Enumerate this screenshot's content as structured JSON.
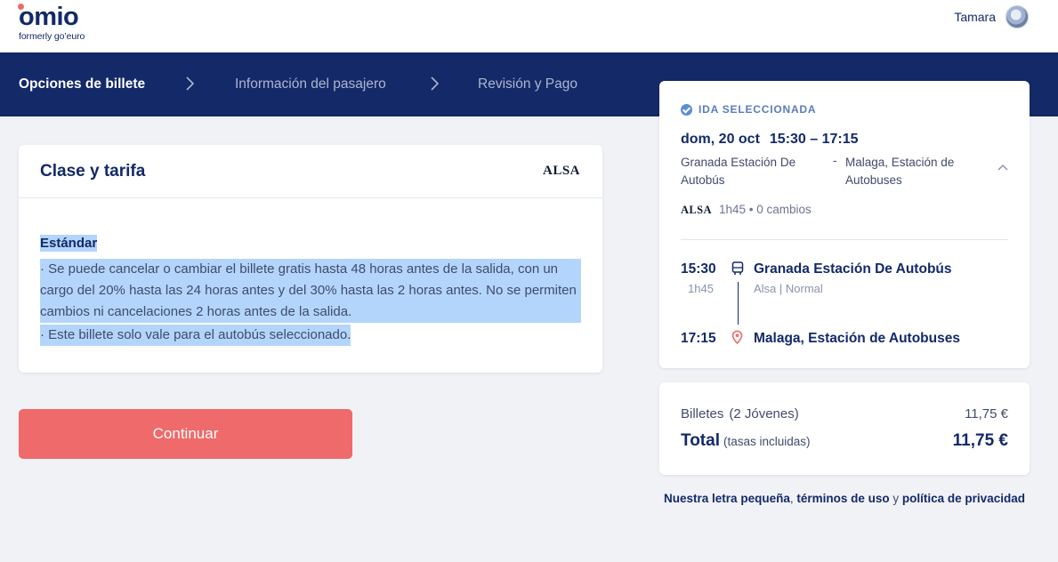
{
  "header": {
    "logo_text": "omio",
    "logo_sub": "formerly go’euro",
    "user_name": "Tamara"
  },
  "steps": [
    {
      "label": "Opciones de billete",
      "active": true
    },
    {
      "label": "Información del pasajero",
      "active": false
    },
    {
      "label": "Revisión y Pago",
      "active": false
    }
  ],
  "fare": {
    "title": "Clase y tarifa",
    "carrier": "ALSA",
    "name": "Estándar",
    "condition_1": "· Se puede cancelar o cambiar el billete gratis hasta 48 horas antes de la salida, con un cargo del 20% hasta las 24 horas antes y del 30% hasta las 2 horas antes. No se permiten cambios ni cancelaciones 2 horas antes de la salida.",
    "condition_2": "· Este billete solo vale para el autobús seleccionado."
  },
  "continue_label": "Continuar",
  "trip": {
    "tag": "IDA SELECCIONADA",
    "date": "dom, 20 oct",
    "times": "15:30 – 17:15",
    "from": "Granada Estación De Autobús",
    "dash": "-",
    "to": "Malaga, Estación de Autobuses",
    "carrier": "ALSA",
    "meta": "1h45 • 0 cambios",
    "dep_time": "15:30",
    "duration": "1h45",
    "dep_station": "Granada Estación De Autobús",
    "operator": "Alsa | Normal",
    "arr_time": "17:15",
    "arr_station": "Malaga, Estación de Autobuses"
  },
  "price": {
    "tickets_label": "Billetes",
    "tickets_detail": "(2 Jóvenes)",
    "tickets_value": "11,75 €",
    "total_label": "Total",
    "total_note": "(tasas incluidas)",
    "total_value": "11,75 €"
  },
  "legal": {
    "part1": "Nuestra letra pequeña",
    "sep1": ",",
    "part2": "términos de uso",
    "sep2": "y",
    "part3": "política de privacidad"
  },
  "colors": {
    "navy": "#132968",
    "accent": "#ef6a6a",
    "selection": "#b4d5fb"
  }
}
